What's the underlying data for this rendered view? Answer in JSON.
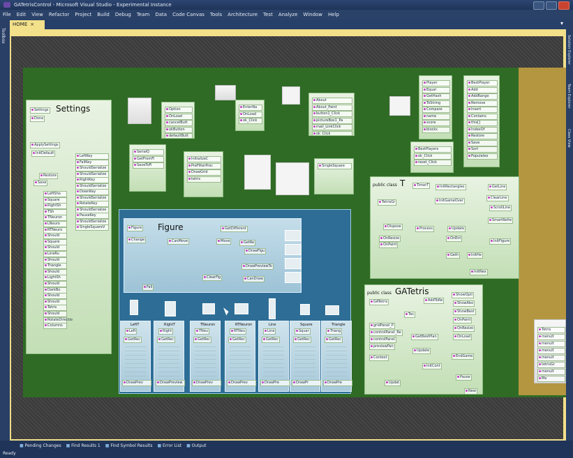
{
  "window": {
    "title": "GATetrisControl - Microsoft Visual Studio - Experimental Instance"
  },
  "menu": [
    "File",
    "Edit",
    "View",
    "Refactor",
    "Project",
    "Build",
    "Debug",
    "Team",
    "Data",
    "Code Canvas",
    "Tools",
    "Architecture",
    "Test",
    "Analyze",
    "Window",
    "Help"
  ],
  "tab": {
    "label": "HOME",
    "close": "×"
  },
  "left_rail": {
    "toolbox": "Toolbox"
  },
  "right_rail": [
    "Solution Explorer",
    "Team Explorer",
    "Class View"
  ],
  "diagram": {
    "settings": {
      "title": "Settings",
      "members": [
        "Settings",
        "Done",
        "ApplySettings",
        "InitDefault",
        "LeftKey",
        "FallKey",
        "ShouldSerialize",
        "ShouldSerialize",
        "RightKey",
        "ShouldSerialize",
        "DownKey",
        "ShouldSerialize",
        "RotateKey",
        "ShouldSerialize",
        "PauseKey",
        "ShouldSerialize",
        "SingleSquareV",
        "Restore",
        "Save",
        "LeftSho",
        "Square",
        "RightSh",
        "TSh",
        "TNeuron",
        "LNeuro",
        "RTNeuro",
        "Should",
        "Square",
        "Should",
        "LineRu",
        "Should",
        "Triangle",
        "Should",
        "LightSh",
        "Should",
        "DarkBo",
        "Should",
        "Should",
        "Tetris",
        "Should",
        "RotateDirectio",
        "Columns"
      ]
    },
    "figure": {
      "title": "Figure",
      "members": [
        "Figure",
        "Change",
        "CanMove",
        "Move",
        "GetDifferent",
        "GetRe",
        "DrawFigu",
        "DrawPreviewTo",
        "ClearFig",
        "CanDraw",
        "Fall"
      ]
    },
    "tetris": {
      "title": "T",
      "prefix": "public class",
      "members": [
        "TimerT",
        "InitRectangles",
        "GetLine",
        "TetrisGr",
        "InitGameOver",
        "ClearLine",
        "ScrollLine",
        "SmartRefre",
        "Process",
        "Update",
        "Dispose",
        "OnResize",
        "OnPaint",
        "OnEnt",
        "InitFigure",
        "Geth",
        "InitHe",
        "InitNex"
      ]
    },
    "gatetris": {
      "title": "GATetris",
      "prefix": "public class",
      "members": [
        "GATetris",
        "AddToRe",
        "ShowOpti",
        "ShowAbo",
        "ShowBest",
        "Tes",
        "OnPaint",
        "OnResize",
        "OnLoad",
        "gridPanel_P",
        "controlPanel_Re",
        "controlPanel",
        "previewPan",
        "GetBestPlan",
        "Update",
        "EndGame",
        "Context",
        "InitCont",
        "Pause",
        "New",
        "Updat"
      ]
    },
    "top_boxes": [
      {
        "members": [
          "Option",
          "OnLoad",
          "cancelButt",
          "okButton",
          "defaultButt"
        ]
      },
      {
        "members": [
          "EnterNa",
          "OnLoad",
          "ok_Click"
        ]
      },
      {
        "members": [
          "About",
          "About_Paint",
          "button1_Click",
          "pictureBox1_Pa",
          "mail_LinkClick",
          "ok_Click"
        ]
      },
      {
        "members": [
          "Player",
          "Equal",
          "GetHash",
          "ToString",
          "Compare",
          "name",
          "score",
          "blocks"
        ]
      },
      {
        "members": [
          "BestPlayer",
          "Add",
          "AddRange",
          "Remove",
          "Insert",
          "Contains",
          "this[]",
          "IndexOf",
          "Restore",
          "Save",
          "Sort",
          "Populates"
        ]
      },
      {
        "members": [
          "SerialQ",
          "GetFromFi",
          "SaveToFi"
        ]
      },
      {
        "members": [
          "InitializeC",
          "PreFilterProc",
          "DrawGrid",
          "tetris"
        ]
      },
      {
        "members": [
          "SingleSquare"
        ]
      },
      {
        "members": [
          "BestPlayers",
          "ok_Click",
          "reset_Click"
        ]
      }
    ],
    "sub_figures": [
      {
        "title": "LeftT",
        "members": [
          "Left",
          "GetRec",
          "DrawPrev"
        ]
      },
      {
        "title": "RightT",
        "members": [
          "Right",
          "GetRec",
          "DrawPreview"
        ]
      },
      {
        "title": "TNeuron",
        "members": [
          "TNeu",
          "GetRec",
          "DrawPrev"
        ]
      },
      {
        "title": "RTNeuron",
        "members": [
          "RTNeu",
          "GetRec",
          "DrawPrev"
        ]
      },
      {
        "title": "Line",
        "members": [
          "Line",
          "GetRec",
          "DrawPre"
        ]
      },
      {
        "title": "Square",
        "members": [
          "Squar",
          "GetRec",
          "DrawPr"
        ]
      },
      {
        "title": "Triangle",
        "members": [
          "Triang",
          "GetRec",
          "DrawPre"
        ]
      }
    ],
    "side_box": {
      "members": [
        "Tetris",
        "menuIt",
        "menuIt",
        "menuIt",
        "menuIt",
        "tetrisGr",
        "menuIt",
        "Me"
      ]
    }
  },
  "bottom_tabs": [
    "Pending Changes",
    "Find Results 1",
    "Find Symbol Results",
    "Error List",
    "Output"
  ],
  "status": {
    "text": "Ready"
  }
}
